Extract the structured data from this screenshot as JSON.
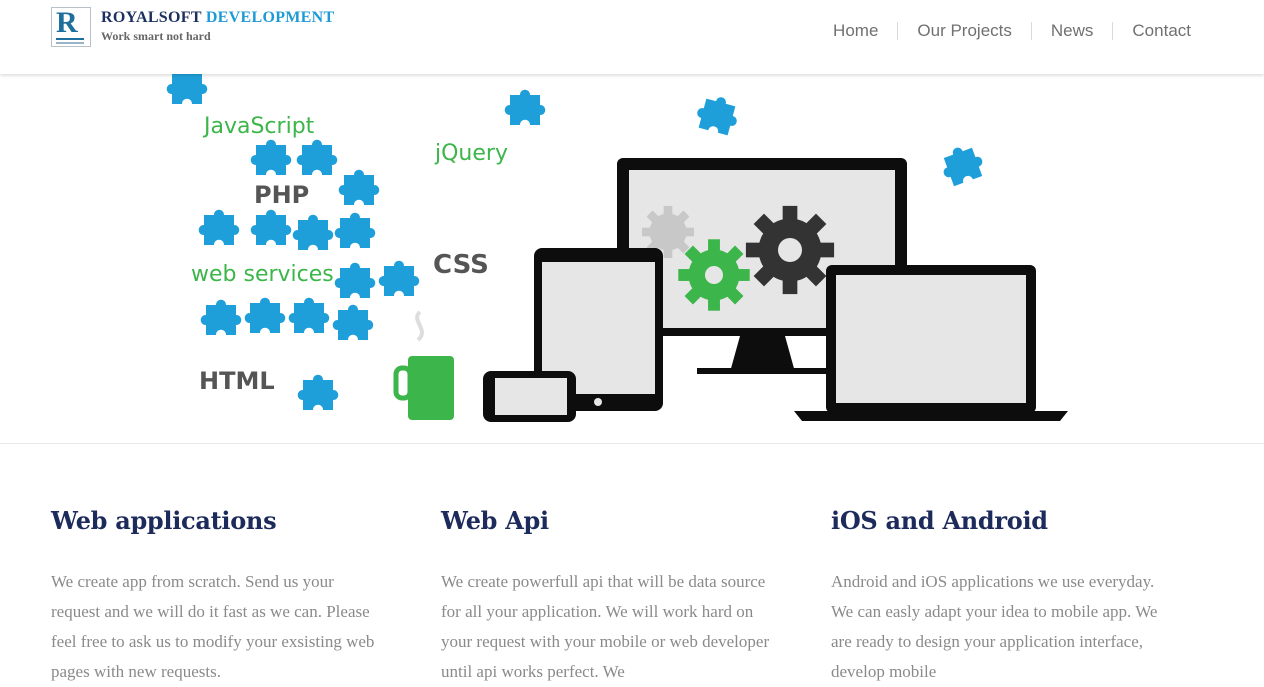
{
  "header": {
    "brand_part1": "ROYALSOFT",
    "brand_part2": "DEVELOPMENT",
    "tagline": "Work smart not hard",
    "logo_letter": "R",
    "nav": [
      "Home",
      "Our Projects",
      "News",
      "Contact"
    ]
  },
  "hero": {
    "tech_labels": [
      "JavaScript",
      "jQuery",
      "PHP",
      "CSS",
      "web services",
      "HTML"
    ],
    "colors": {
      "puzzle": "#1f9fd9",
      "green": "#3cb54a",
      "device": "#0d0d0d",
      "screen": "#e6e6e6"
    }
  },
  "features": [
    {
      "title": "Web applications",
      "text": "We create app from scratch. Send us your request and we will do it fast as we can. Please feel free to ask us to modify your exsisting web pages with new requests."
    },
    {
      "title": "Web Api",
      "text": "We create powerfull api that will be data source for all your application. We will work hard on your request with your mobile or web developer until api works perfect. We"
    },
    {
      "title": "iOS and Android",
      "text": "Android and iOS applications we use everyday. We can easly adapt your idea to mobile app. We are ready to design your application interface, develop mobile"
    }
  ]
}
